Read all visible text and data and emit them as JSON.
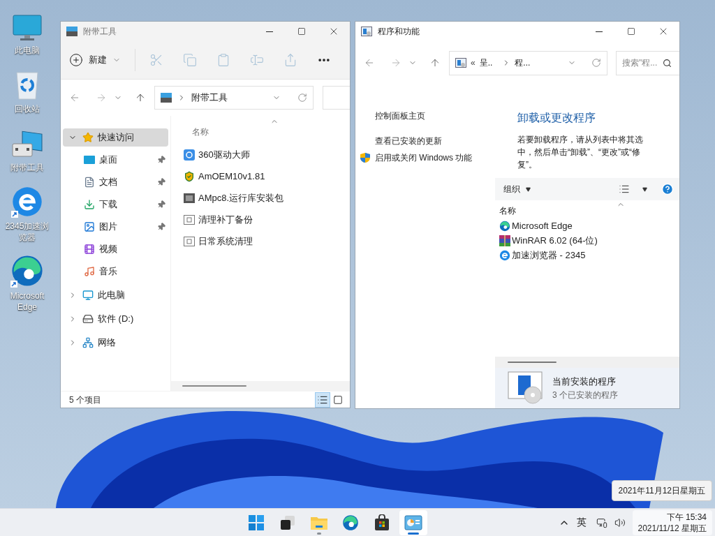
{
  "desktop_icons": [
    {
      "kind": "monitor",
      "label": "此电脑",
      "shortcut": false
    },
    {
      "kind": "recycle",
      "label": "回收站",
      "shortcut": false
    },
    {
      "kind": "tools",
      "label": "附带工具",
      "shortcut": false
    },
    {
      "kind": "ie",
      "label": "2345加速浏览器",
      "shortcut": true
    },
    {
      "kind": "edge",
      "label": "Microsoft Edge",
      "shortcut": true
    }
  ],
  "explorer": {
    "title": "附带工具",
    "toolbar": {
      "new_label": "新建",
      "actions": [
        {
          "kind": "cut",
          "disabled": true
        },
        {
          "kind": "copy",
          "disabled": true
        },
        {
          "kind": "paste",
          "disabled": true
        },
        {
          "kind": "rename",
          "disabled": true
        },
        {
          "kind": "share",
          "disabled": true
        },
        {
          "kind": "more",
          "disabled": false
        }
      ]
    },
    "address": {
      "crumbs": [
        "附带工具"
      ]
    },
    "sidebar": [
      {
        "kind": "star",
        "label": "快速访问",
        "selected": true,
        "expanded": true,
        "children": [
          {
            "kind": "desktop",
            "label": "桌面",
            "selected": false,
            "pinned": true
          },
          {
            "kind": "docs",
            "label": "文档",
            "selected": false,
            "pinned": true
          },
          {
            "kind": "download",
            "label": "下载",
            "selected": false,
            "pinned": true
          },
          {
            "kind": "pictures",
            "label": "图片",
            "selected": false,
            "pinned": true
          },
          {
            "kind": "video",
            "label": "视频",
            "selected": false,
            "pinned": false
          },
          {
            "kind": "music",
            "label": "音乐",
            "selected": false,
            "pinned": false
          }
        ]
      },
      {
        "kind": "pc",
        "label": "此电脑",
        "selected": false,
        "expanded": false
      },
      {
        "kind": "drive",
        "label": "软件 (D:)",
        "selected": false,
        "expanded": false
      },
      {
        "kind": "network",
        "label": "网络",
        "selected": false,
        "expanded": false
      }
    ],
    "column": "名称",
    "files": [
      {
        "kind": "app360",
        "name": "360驱动大师"
      },
      {
        "kind": "shield",
        "name": "AmOEM10v1.81"
      },
      {
        "kind": "exe",
        "name": "AMpc8.运行库安装包"
      },
      {
        "kind": "shortcut",
        "name": "清理补丁备份"
      },
      {
        "kind": "shortcut",
        "name": "日常系统清理"
      }
    ],
    "status": "5 个项目",
    "views": [
      {
        "kind": "details",
        "selected": true
      },
      {
        "kind": "tiles",
        "selected": false
      }
    ]
  },
  "control_panel": {
    "title": "程序和功能",
    "address": {
      "prefix": "«",
      "crumbs": [
        "呈..",
        "程..."
      ]
    },
    "search_placeholder": "搜索\"程...",
    "links": [
      {
        "kind": "plain",
        "text": "控制面板主页"
      },
      {
        "kind": "plain",
        "text": "查看已安装的更新"
      },
      {
        "kind": "shield",
        "text": "启用或关闭 Windows 功能"
      }
    ],
    "heading": "卸载或更改程序",
    "description": "若要卸载程序，请从列表中将其选中，然后单击“卸载”、“更改”或“修复”。",
    "organize": "组织",
    "column": "名称",
    "programs": [
      {
        "kind": "edge",
        "name": "Microsoft Edge"
      },
      {
        "kind": "winrar",
        "name": "WinRAR 6.02 (64-位)"
      },
      {
        "kind": "ie",
        "name": "加速浏览器 - 2345"
      }
    ],
    "footer": {
      "title": "当前安装的程序",
      "subtitle": "3 个已安装的程序"
    }
  },
  "tooltip": "2021年11月12日星期五",
  "taskbar": {
    "apps": [
      {
        "kind": "start",
        "running": false,
        "selected": false
      },
      {
        "kind": "taskview",
        "running": false,
        "selected": false
      },
      {
        "kind": "folder",
        "running": true,
        "selected": false
      },
      {
        "kind": "edge",
        "running": false,
        "selected": false
      },
      {
        "kind": "store",
        "running": false,
        "selected": false
      },
      {
        "kind": "controlpanel",
        "running": true,
        "selected": true
      }
    ],
    "ime": "英",
    "time": "下午 15:34",
    "date": "2021/11/12 星期五"
  }
}
